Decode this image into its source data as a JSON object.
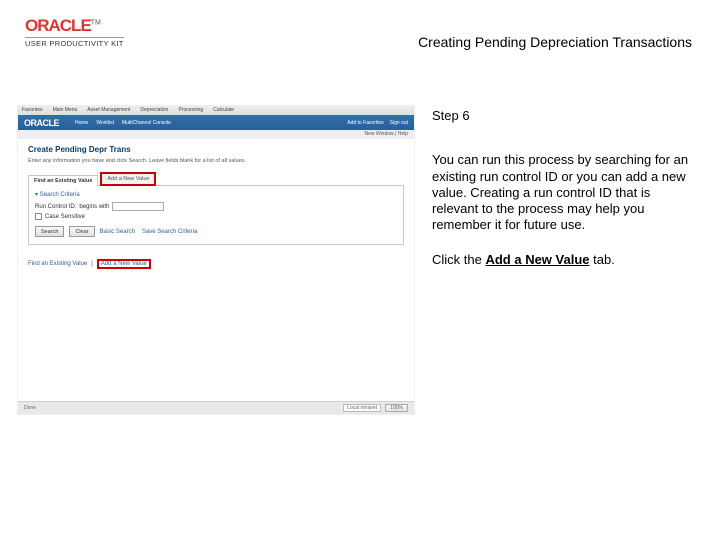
{
  "logo": {
    "brand": "ORACLE",
    "tm": "TM",
    "sub": "USER PRODUCTIVITY KIT"
  },
  "title": "Creating Pending Depreciation Transactions",
  "right": {
    "step": "Step 6",
    "body": "You can run this process by searching for an existing run control ID or you can add a new value. Creating a run control ID that is relevant to the process may help you remember it for future use.",
    "click_pre": "Click the ",
    "click_bold": "Add a New Value",
    "click_post": " tab."
  },
  "ss": {
    "topmenu": [
      "Favorites",
      "Main Menu",
      "Asset Management",
      "Depreciation",
      "Processing",
      "Calculate"
    ],
    "nav": {
      "brand": "ORACLE",
      "links": [
        "Home",
        "Worklist",
        "MultiChannel Console",
        "Add to Favorites",
        "Sign out"
      ]
    },
    "newwin": "New Window | Help",
    "h1": "Create Pending Depr Trans",
    "desc": "Enter any information you have and click Search. Leave fields blank for a list of all values.",
    "tab_find": "Find an Existing Value",
    "tab_add": "Add a New Value",
    "legend": "▾ Search Criteria",
    "field_label": "Run Control ID:",
    "field_op": "begins with",
    "chk_label": "Case Sensitive",
    "btn_search": "Search",
    "btn_clear": "Clear",
    "basic": "Basic Search",
    "save": "Save Search Criteria",
    "link_find": "Find an Existing Value",
    "link_add": "Add a New Value",
    "footer": {
      "done": "Done",
      "net": "Local intranet",
      "zoom": "100%"
    }
  }
}
